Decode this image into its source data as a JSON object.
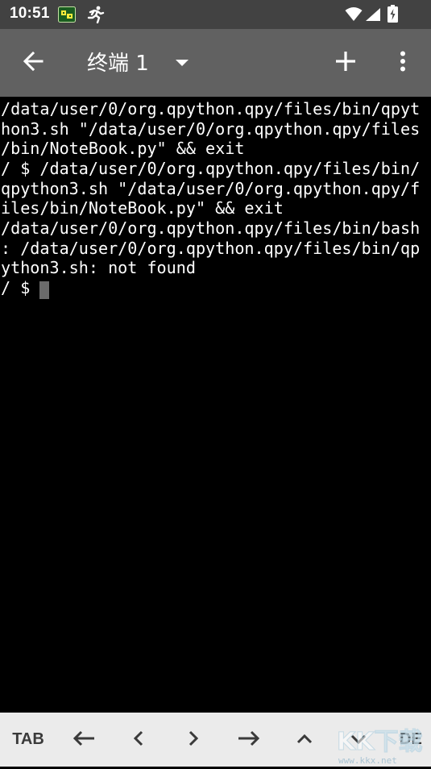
{
  "status_bar": {
    "time": "10:51",
    "icons": [
      "qpython-notification-icon",
      "running-person-icon",
      "wifi-icon",
      "cell-signal-icon",
      "battery-charging-icon"
    ]
  },
  "app_bar": {
    "title": "终端 1",
    "back_icon": "arrow-back-icon",
    "dropdown_icon": "dropdown-arrow-icon",
    "add_icon": "plus-icon",
    "menu_icon": "more-vert-icon"
  },
  "terminal": {
    "lines": [
      "/data/user/0/org.qpython.qpy/files/bin/qpyt",
      "hon3.sh \"/data/user/0/org.qpython.qpy/files",
      "/bin/NoteBook.py\" && exit",
      "/ $ /data/user/0/org.qpython.qpy/files/bin/",
      "qpython3.sh \"/data/user/0/org.qpython.qpy/f",
      "iles/bin/NoteBook.py\" && exit",
      "/data/user/0/org.qpython.qpy/files/bin/bash",
      ": /data/user/0/org.qpython.qpy/files/bin/qp",
      "ython3.sh: not found",
      "/ $ "
    ]
  },
  "extra_keys": {
    "tab": "TAB",
    "del": "DE",
    "icons": [
      "left-arrow-icon",
      "chevron-left-icon",
      "chevron-right-icon",
      "right-arrow-icon",
      "chevron-up-icon",
      "chevron-down-icon"
    ]
  },
  "watermark": {
    "brand": "KK下载",
    "url": "www.kkx.net"
  }
}
